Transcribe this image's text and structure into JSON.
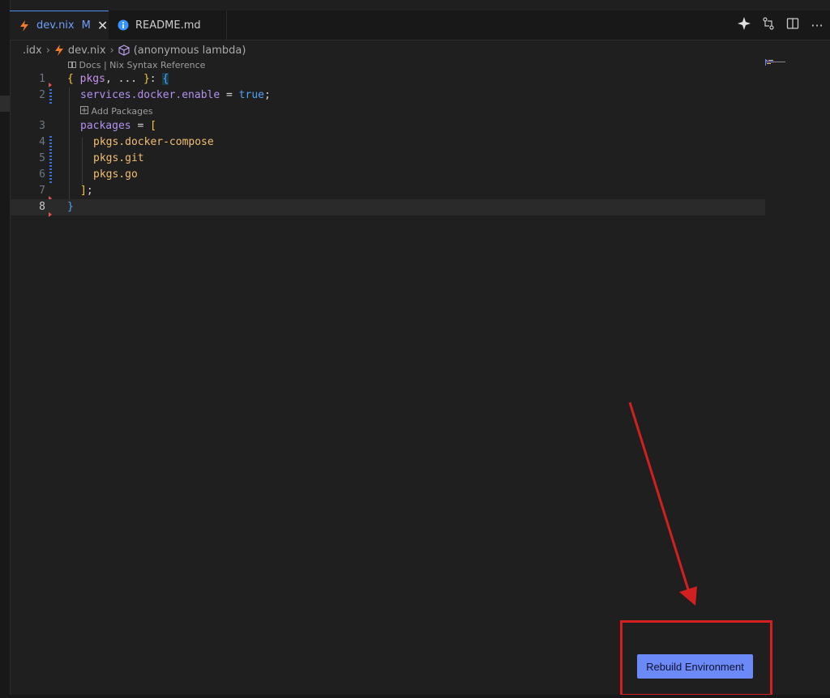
{
  "tabs": [
    {
      "label": "dev.nix",
      "modified": "M",
      "close": "✕"
    },
    {
      "label": "README.md"
    }
  ],
  "breadcrumb": {
    "items": [
      ".idx",
      "dev.nix",
      "(anonymous lambda)"
    ],
    "sep": "›"
  },
  "codelens": {
    "top": "Docs | Nix Syntax Reference",
    "add_packages": "Add Packages"
  },
  "editor": {
    "lines": [
      {
        "n": "1"
      },
      {
        "n": "2"
      },
      {
        "n": "3"
      },
      {
        "n": "4"
      },
      {
        "n": "5"
      },
      {
        "n": "6"
      },
      {
        "n": "7"
      },
      {
        "n": "8"
      }
    ],
    "tokens": {
      "l1a": "{ ",
      "l1b": "pkgs",
      "l1c": ", ... ",
      "l1d": "}",
      "l1e": ": ",
      "l1f": "{",
      "l2a": "services.docker.enable",
      "l2b": " = ",
      "l2c": "true",
      "l2d": ";",
      "l3a": "packages",
      "l3b": " = ",
      "l3c": "[",
      "l4": "pkgs.docker-compose",
      "l5": "pkgs.git",
      "l6": "pkgs.go",
      "l7a": "]",
      "l7b": ";",
      "l8": "}"
    }
  },
  "rebuild_button": {
    "label": "Rebuild Environment"
  },
  "colors": {
    "accent": "#4f8ff7",
    "button": "#6b8af7",
    "annotation": "#d21f1f"
  }
}
